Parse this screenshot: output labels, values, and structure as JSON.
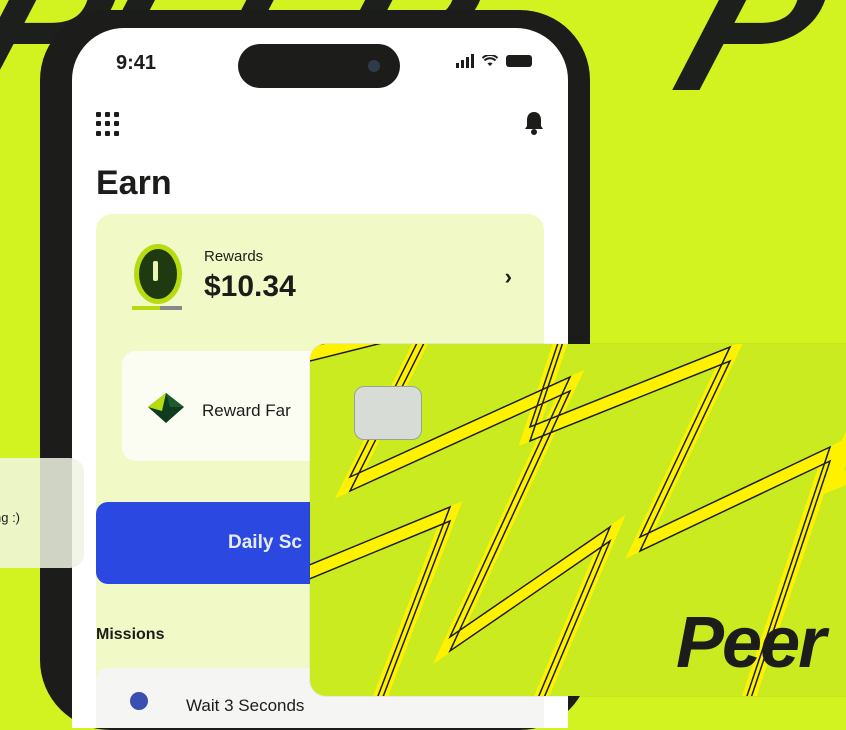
{
  "background": {
    "color": "#d2f31f",
    "text_left": "PEER",
    "text_right": "P"
  },
  "status_bar": {
    "time": "9:41"
  },
  "icons": {
    "menu": "grid-icon",
    "notifications": "bell-icon",
    "rewards": "coin-icon",
    "farm": "gem-icon",
    "mission": "mission-icon"
  },
  "page": {
    "title": "Earn"
  },
  "rewards": {
    "label": "Rewards",
    "amount": "$10.34",
    "chevron": "›"
  },
  "farm": {
    "label": "Reward Far"
  },
  "daily": {
    "label": "Daily Sc"
  },
  "missions": {
    "title": "Missions",
    "items": [
      {
        "label": "Wait 3 Seconds"
      }
    ]
  },
  "toast": {
    "text": "ng :)"
  },
  "card": {
    "brand": "Peer",
    "accent": "#fff200"
  }
}
